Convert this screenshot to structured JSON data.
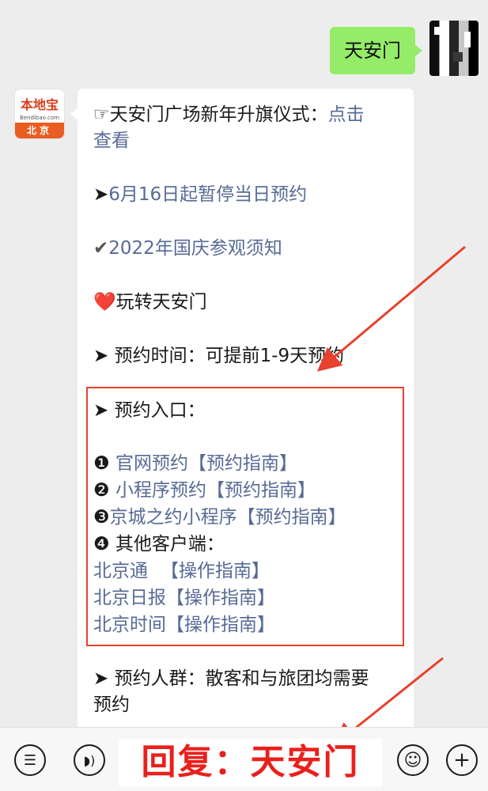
{
  "outgoing": {
    "text": "天安门"
  },
  "bot": {
    "logo_text": "本地宝",
    "logo_sub": "Bendibao.com",
    "logo_city": "北京"
  },
  "card": {
    "lines": [
      {
        "icon": "☞",
        "text": "天安门广场新年升旗仪式：",
        "link": "点击"
      },
      {
        "link": "查看"
      },
      {
        "icon": "➤",
        "link": "6月16日起暂停当日预约"
      },
      {
        "icon": "✔",
        "link": "2022年国庆参观须知"
      },
      {
        "icon": "❤️",
        "text": "玩转天安门"
      },
      {
        "text": "➤ 预约时间：可提前1-9天预约"
      },
      {
        "text": "➤ 预约入口："
      },
      {
        "num": "❶",
        "link": "官网预约",
        "guide": "【预约指南】"
      },
      {
        "num": "❷",
        "link": "小程序预约",
        "guide": "【预约指南】"
      },
      {
        "num": "❸",
        "link": "京城之约小程序",
        "guide": "【预约指南】"
      },
      {
        "text": "❹ 其他客户端："
      },
      {
        "link": "北京通",
        "guide": "【操作指南】"
      },
      {
        "link": "北京日报",
        "guide": "【操作指南】"
      },
      {
        "link": "北京时间",
        "guide": "【操作指南】"
      },
      {
        "text": "➤ 预约人群：散客和与旅团均需要"
      },
      {
        "text": "预约"
      }
    ]
  },
  "bottom": {
    "reply_hint": "回复：天安门"
  },
  "colors": {
    "highlight_red": "#e8412d",
    "link_blue": "#576b95",
    "bubble_green": "#95ec69"
  }
}
